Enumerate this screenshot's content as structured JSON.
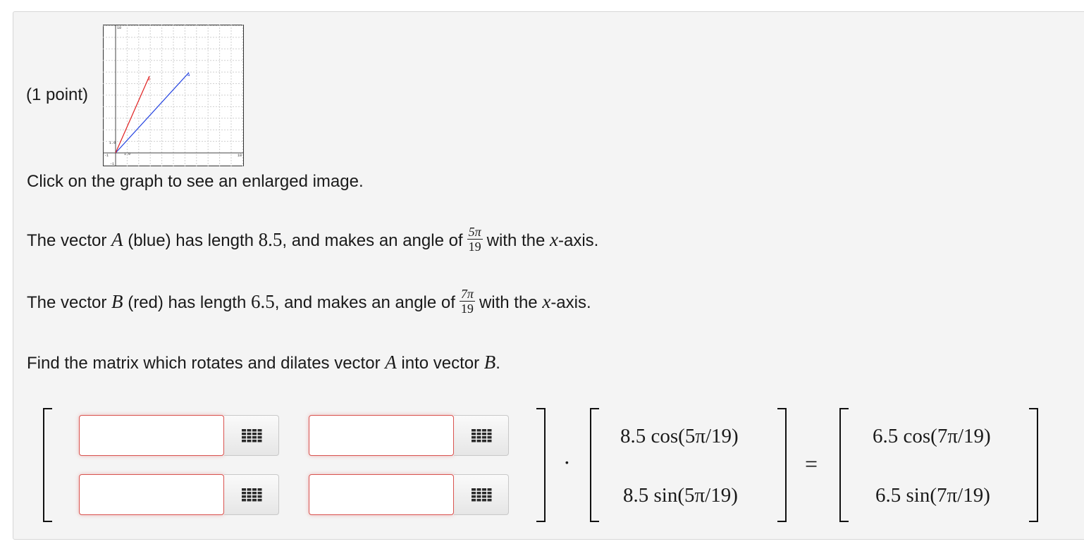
{
  "points_label": "(1 point)",
  "graph": {
    "tick_labels": {
      "y_top": "10",
      "x_right": "10",
      "x_left": "-1",
      "y_bottom": "-1",
      "x_unit": "1.0",
      "y_unit": "1.0"
    },
    "vector_a_label": "a",
    "vector_b_label": "b",
    "colors": {
      "vector_a": "#1f3fe0",
      "vector_b": "#e01f1f"
    }
  },
  "click_hint": "Click on the graph to see an enlarged image.",
  "line_a": {
    "prefix": "The vector ",
    "var": "A",
    "desc": " (blue) has length ",
    "length": "8.5",
    "mid": ", and makes an angle of",
    "angle_num": "5π",
    "angle_den": "19",
    "suffix_1": "with the ",
    "axis_var": "x",
    "suffix_2": "-axis."
  },
  "line_b": {
    "prefix": "The vector ",
    "var": "B",
    "desc": " (red) has length ",
    "length": "6.5",
    "mid": ", and makes an angle of",
    "angle_num": "7π",
    "angle_den": "19",
    "suffix_1": "with the ",
    "axis_var": "x",
    "suffix_2": "-axis."
  },
  "question": {
    "prefix": "Find the matrix which rotates and dilates vector ",
    "var_a": "A",
    "mid": " into vector ",
    "var_b": "B",
    "end": "."
  },
  "matrix_inputs": [
    {
      "value": "",
      "placeholder": ""
    },
    {
      "value": "",
      "placeholder": ""
    },
    {
      "value": "",
      "placeholder": ""
    },
    {
      "value": "",
      "placeholder": ""
    }
  ],
  "vector_a_entries": [
    "8.5 cos(5π/19)",
    "8.5 sin(5π/19)"
  ],
  "vector_b_entries": [
    "6.5 cos(7π/19)",
    "6.5 sin(7π/19)"
  ],
  "dot_operator": "·",
  "equals_operator": "=",
  "colors": {
    "input_border_error": "#d9534f",
    "panel_bg": "#f4f4f4"
  }
}
